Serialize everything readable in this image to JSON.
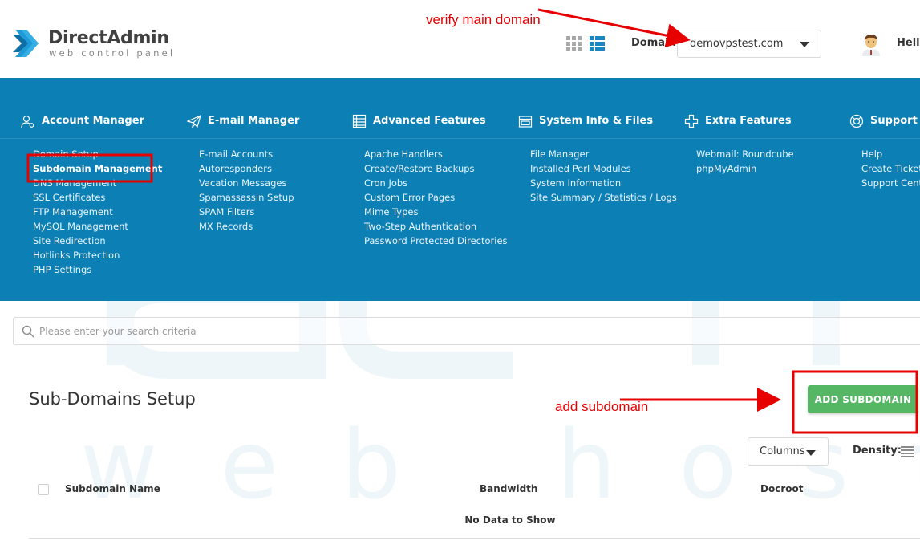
{
  "brand": {
    "name": "DirectAdmin",
    "tagline": "web control panel",
    "mark_color": "#1e9ad6"
  },
  "header": {
    "domain_label": "Domain",
    "domain_value": "demovpstest.com",
    "greeting": "Hello"
  },
  "annotations": {
    "verify": "verify main domain",
    "add": "add subdomain",
    "color": "#e60000"
  },
  "menu": {
    "background": "#0c7fb4",
    "sections": [
      {
        "title": "Account Manager",
        "icon": "user-gear-icon",
        "items": [
          "Domain Setup",
          "Subdomain Management",
          "DNS Management",
          "SSL Certificates",
          "FTP Management",
          "MySQL Management",
          "Site Redirection",
          "Hotlinks Protection",
          "PHP Settings"
        ]
      },
      {
        "title": "E-mail Manager",
        "icon": "paper-plane-icon",
        "items": [
          "E-mail Accounts",
          "Autoresponders",
          "Vacation Messages",
          "Spamassassin Setup",
          "SPAM Filters",
          "MX Records"
        ]
      },
      {
        "title": "Advanced Features",
        "icon": "list-sliders-icon",
        "items": [
          "Apache Handlers",
          "Create/Restore Backups",
          "Cron Jobs",
          "Custom Error Pages",
          "Mime Types",
          "Two-Step Authentication",
          "Password Protected Directories"
        ]
      },
      {
        "title": "System Info & Files",
        "icon": "folder-window-icon",
        "items": [
          "File Manager",
          "Installed Perl Modules",
          "System Information",
          "Site Summary / Statistics / Logs"
        ]
      },
      {
        "title": "Extra Features",
        "icon": "plus-cross-icon",
        "items": [
          "Webmail: Roundcube",
          "phpMyAdmin"
        ]
      },
      {
        "title": "Support & Help",
        "icon": "lifebuoy-icon",
        "items": [
          "Help",
          "Create Ticket",
          "Support Center"
        ]
      }
    ]
  },
  "search": {
    "placeholder": "Please enter your search criteria"
  },
  "content": {
    "title": "Sub-Domains Setup",
    "add_button": "ADD SUBDOMAIN",
    "columns_button": "Columns",
    "density_label": "Density:",
    "columns": [
      "Subdomain Name",
      "Bandwidth",
      "Docroot"
    ],
    "empty_text": "No Data to Show",
    "add_button_color": "#55b764"
  },
  "watermark": {
    "text": "web hosting"
  }
}
